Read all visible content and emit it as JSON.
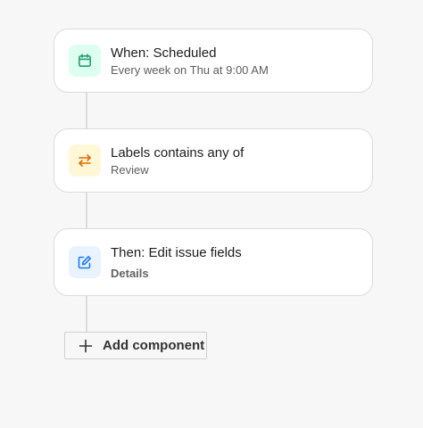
{
  "flow": {
    "steps": [
      {
        "title": "When: Scheduled",
        "subtitle": "Every week on Thu at 9:00 AM",
        "icon": "calendar-icon",
        "icon_color": "#22a06b",
        "icon_bg": "#dcfff1"
      },
      {
        "title": "Labels contains any of",
        "subtitle": "Review",
        "icon": "swap-arrows-icon",
        "icon_color": "#e06c00",
        "icon_bg": "#fff7d6"
      },
      {
        "title": "Then: Edit issue fields",
        "subtitle": "Details",
        "icon": "edit-icon",
        "icon_color": "#1d7afc",
        "icon_bg": "#e9f2ff"
      }
    ],
    "add_button": {
      "label": "Add component",
      "icon": "plus-icon"
    }
  },
  "colors": {
    "background": "#f7f7f7",
    "card_border": "#dcdcdc",
    "connector": "#dcdcdc"
  }
}
